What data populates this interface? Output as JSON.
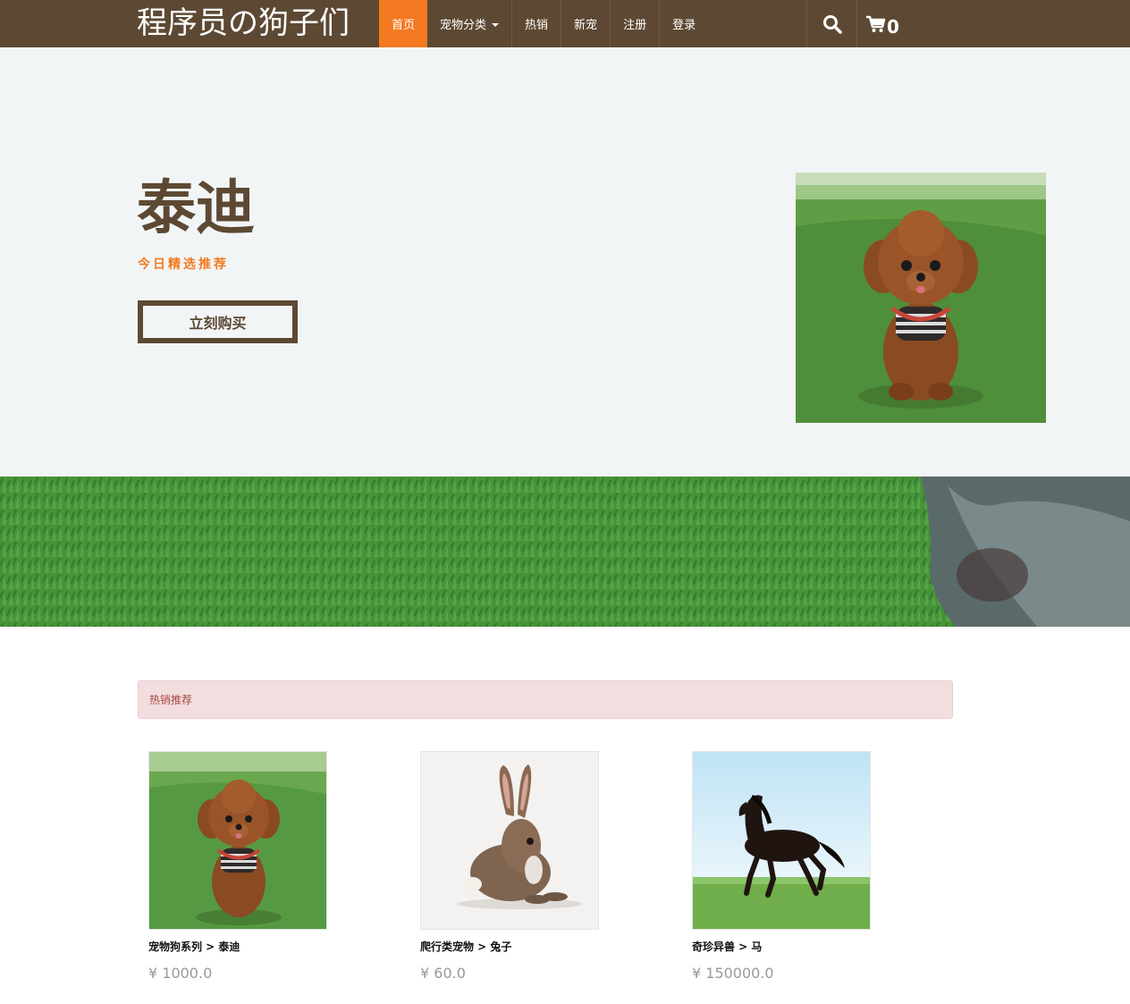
{
  "navbar": {
    "brand": "程序员の狗子们",
    "items": [
      {
        "label": "首页",
        "active": true
      },
      {
        "label": "宠物分类",
        "dropdown": true
      },
      {
        "label": "热销"
      },
      {
        "label": "新宠"
      },
      {
        "label": "注册"
      },
      {
        "label": "登录"
      }
    ],
    "search_icon": "search-icon",
    "cart_icon": "cart-icon",
    "cart_count": "0"
  },
  "hero": {
    "title": "泰迪",
    "subtitle": "今日精选推荐",
    "buy_label": "立刻购买"
  },
  "hot": {
    "heading": "热销推荐",
    "products": [
      {
        "name": "宠物狗系列 > 泰迪",
        "price": "¥ 1000.0"
      },
      {
        "name": "爬行类宠物 > 兔子",
        "price": "¥ 60.0"
      },
      {
        "name": "奇珍异兽 > 马",
        "price": "¥ 150000.0"
      }
    ]
  },
  "colors": {
    "nav_bg": "#5d4933",
    "accent": "#f47920",
    "hero_bg": "#f2f5f6",
    "panel_bg": "#f2dede",
    "panel_text": "#a94442"
  }
}
